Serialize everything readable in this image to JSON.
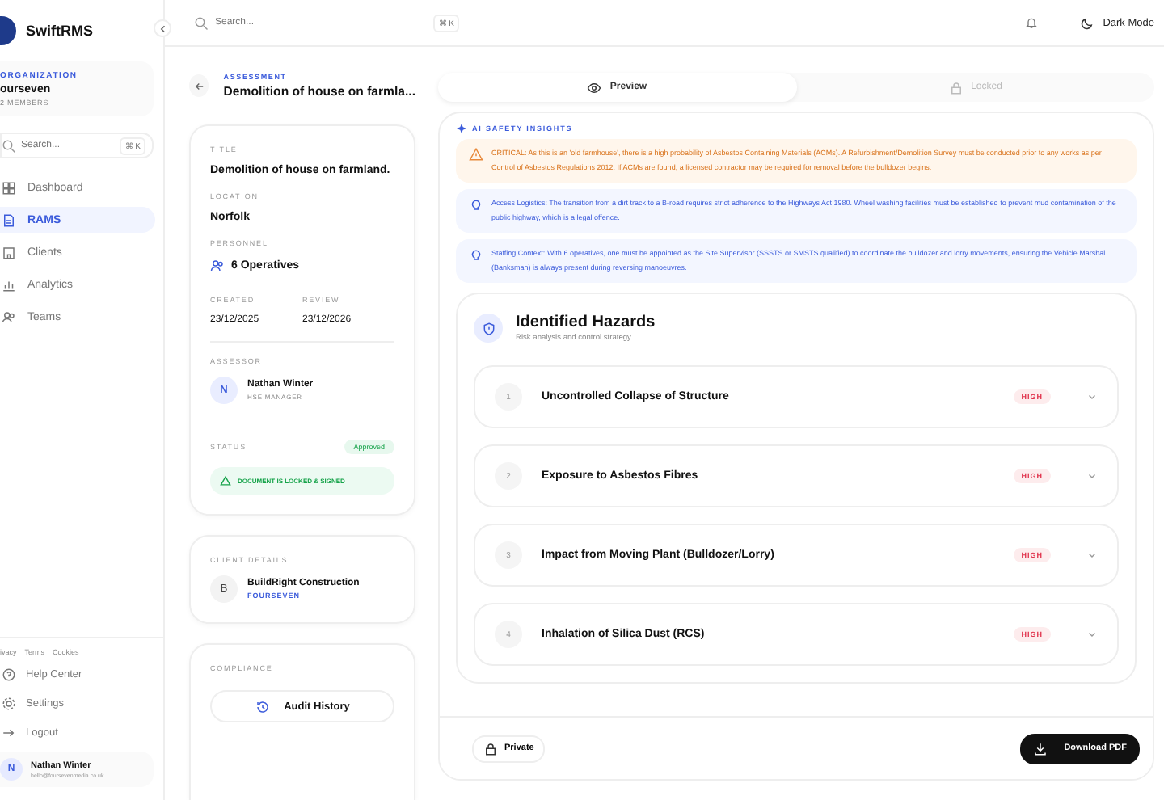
{
  "sidebar": {
    "brand": "SwiftRMS",
    "organization": {
      "label": "ORGANIZATION",
      "name": "ourseven",
      "members": "2 MEMBERS"
    },
    "search": {
      "placeholder": "Search...",
      "shortcut": "⌘ K"
    },
    "nav": [
      {
        "label": "Dashboard",
        "kind": "grid",
        "selected": false
      },
      {
        "label": "RAMS",
        "kind": "doc",
        "selected": true
      },
      {
        "label": "Clients",
        "kind": "building",
        "selected": false
      },
      {
        "label": "Analytics",
        "kind": "chart",
        "selected": false
      },
      {
        "label": "Teams",
        "kind": "people",
        "selected": false
      }
    ],
    "legal_links": [
      "ivacy",
      "Terms",
      "Cookies"
    ],
    "bottom": [
      {
        "label": "Help Center",
        "kind": "help"
      },
      {
        "label": "Settings",
        "kind": "gear"
      },
      {
        "label": "Logout",
        "kind": "logout"
      }
    ],
    "user": {
      "initial": "N",
      "name": "Nathan Winter",
      "email": "hello@foursevenmedia.co.uk"
    }
  },
  "topbar": {
    "search": {
      "placeholder": "Search...",
      "shortcut": "⌘ K"
    },
    "dark_mode": "Dark Mode"
  },
  "assessment": {
    "eyebrow": "ASSESSMENT",
    "title": "Demolition of house on farmla..."
  },
  "details": {
    "title_label": "TITLE",
    "title": "Demolition of house on farmland.",
    "location_label": "LOCATION",
    "location": "Norfolk",
    "personnel_label": "PERSONNEL",
    "personnel": "6 Operatives",
    "created_label": "CREATED",
    "created": "23/12/2025",
    "review_label": "REVIEW",
    "review": "23/12/2026",
    "assessor_label": "ASSESSOR",
    "assessor": {
      "initial": "N",
      "name": "Nathan Winter",
      "role": "HSE MANAGER"
    },
    "status_label": "STATUS",
    "status": "Approved",
    "lock_note": "DOCUMENT IS LOCKED & SIGNED"
  },
  "client": {
    "label": "CLIENT DETAILS",
    "initial": "B",
    "name": "BuildRight Construction",
    "org": "FOURSEVEN"
  },
  "compliance": {
    "label": "COMPLIANCE",
    "button": "Audit History"
  },
  "tabs": [
    {
      "label": "Preview",
      "selected": true,
      "disabled": false
    },
    {
      "label": "Locked",
      "selected": false,
      "disabled": true
    }
  ],
  "insights": {
    "heading": "AI SAFETY INSIGHTS",
    "items": [
      {
        "kind": "critical",
        "text": "CRITICAL: As this is an 'old farmhouse', there is a high probability of Asbestos Containing Materials (ACMs). A Refurbishment/Demolition Survey must be conducted prior to any works as per Control of Asbestos Regulations 2012. If ACMs are found, a licensed contractor may be required for removal before the bulldozer begins."
      },
      {
        "kind": "tip",
        "text": "Access Logistics: The transition from a dirt track to a B-road requires strict adherence to the Highways Act 1980. Wheel washing facilities must be established to prevent mud contamination of the public highway, which is a legal offence."
      },
      {
        "kind": "tip",
        "text": "Staffing Context: With 6 operatives, one must be appointed as the Site Supervisor (SSSTS or SMSTS qualified) to coordinate the bulldozer and lorry movements, ensuring the Vehicle Marshal (Banksman) is always present during reversing manoeuvres."
      }
    ]
  },
  "hazards": {
    "title": "Identified Hazards",
    "subtitle": "Risk analysis and control strategy.",
    "items": [
      {
        "number": "1",
        "title": "Uncontrolled Collapse of Structure",
        "risk": "HIGH",
        "expanded": false
      },
      {
        "number": "2",
        "title": "Exposure to Asbestos Fibres",
        "risk": "HIGH",
        "expanded": false
      },
      {
        "number": "3",
        "title": "Impact from Moving Plant (Bulldozer/Lorry)",
        "risk": "HIGH",
        "expanded": false
      },
      {
        "number": "4",
        "title": "Inhalation of Silica Dust (RCS)",
        "risk": "HIGH",
        "expanded": false
      }
    ]
  },
  "footer": {
    "visibility": "Private",
    "download": "Download PDF"
  }
}
